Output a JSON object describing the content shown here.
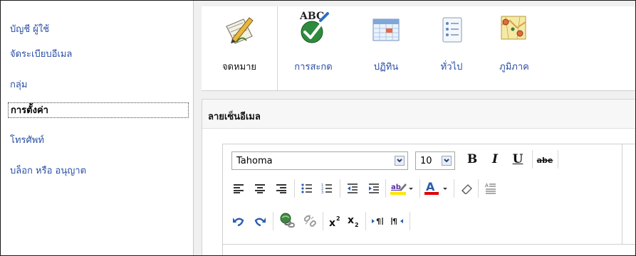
{
  "sidebar": {
    "items": [
      {
        "label": "บัญชี ผู้ใช้",
        "active": false
      },
      {
        "label": "จัดระเบียบอีเมล",
        "active": false
      },
      {
        "label": "กลุ่ม",
        "active": false
      },
      {
        "label": "การตั้งค่า",
        "active": true
      },
      {
        "label": "โทรศัพท์",
        "active": false
      },
      {
        "label": "บล็อก หรือ อนุญาต",
        "active": false
      }
    ]
  },
  "tabs": [
    {
      "label": "จดหมาย",
      "icon": "mail-pencil-icon",
      "active": true
    },
    {
      "label": "การสะกด",
      "icon": "abc-check-icon",
      "active": false
    },
    {
      "label": "ปฏิทิน",
      "icon": "calendar-icon",
      "active": false
    },
    {
      "label": "ทั่วไป",
      "icon": "general-list-icon",
      "active": false
    },
    {
      "label": "ภูมิภาค",
      "icon": "region-map-icon",
      "active": false
    }
  ],
  "panel": {
    "title": "ลายเซ็นอีเมล"
  },
  "toolbar": {
    "font_family": "Tahoma",
    "font_size": "10",
    "bold": "B",
    "italic": "I",
    "underline": "U",
    "strike": "abe",
    "highlight_label": "ab",
    "font_color_label": "A"
  },
  "colors": {
    "link": "#2a4fa6",
    "highlight": "#ffe600",
    "font_color": "#e00000"
  }
}
